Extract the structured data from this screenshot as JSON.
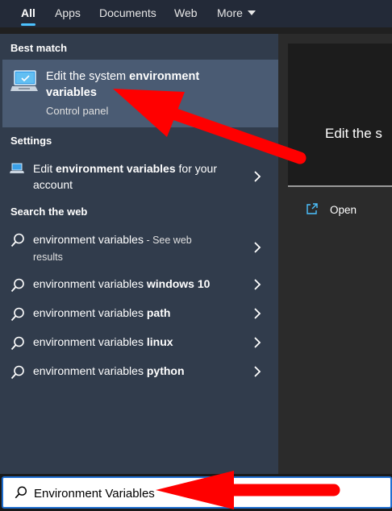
{
  "tabs": [
    {
      "label": "All",
      "active": true
    },
    {
      "label": "Apps"
    },
    {
      "label": "Documents"
    },
    {
      "label": "Web"
    },
    {
      "label": "More"
    }
  ],
  "best_match": {
    "header": "Best match",
    "title_normal": "Edit the system ",
    "title_bold": "environment",
    "title_line2": "variables",
    "subtitle": "Control panel",
    "icon": "system-settings-icon"
  },
  "settings": {
    "header": "Settings",
    "item": {
      "prefix": "Edit ",
      "bold": "environment variables",
      "suffix": " for your",
      "line2": "account",
      "icon": "laptop-icon"
    }
  },
  "web": {
    "header": "Search the web",
    "items": [
      {
        "normal": "environment variables",
        "bold": "",
        "extra": " - See web",
        "extra2": "results"
      },
      {
        "normal": "environment variables ",
        "bold": "windows 10"
      },
      {
        "normal": "environment variables ",
        "bold": "path"
      },
      {
        "normal": "environment variables ",
        "bold": "linux"
      },
      {
        "normal": "environment variables ",
        "bold": "python"
      }
    ]
  },
  "preview": {
    "title": "Edit the s",
    "open_label": "Open",
    "open_icon": "open-external-icon"
  },
  "search": {
    "value": "Environment Variables",
    "icon": "search-icon"
  },
  "colors": {
    "accent": "#4cc2ff",
    "annotation": "#ff0000",
    "panel": "#313c4c",
    "selected": "#4a5b73"
  }
}
